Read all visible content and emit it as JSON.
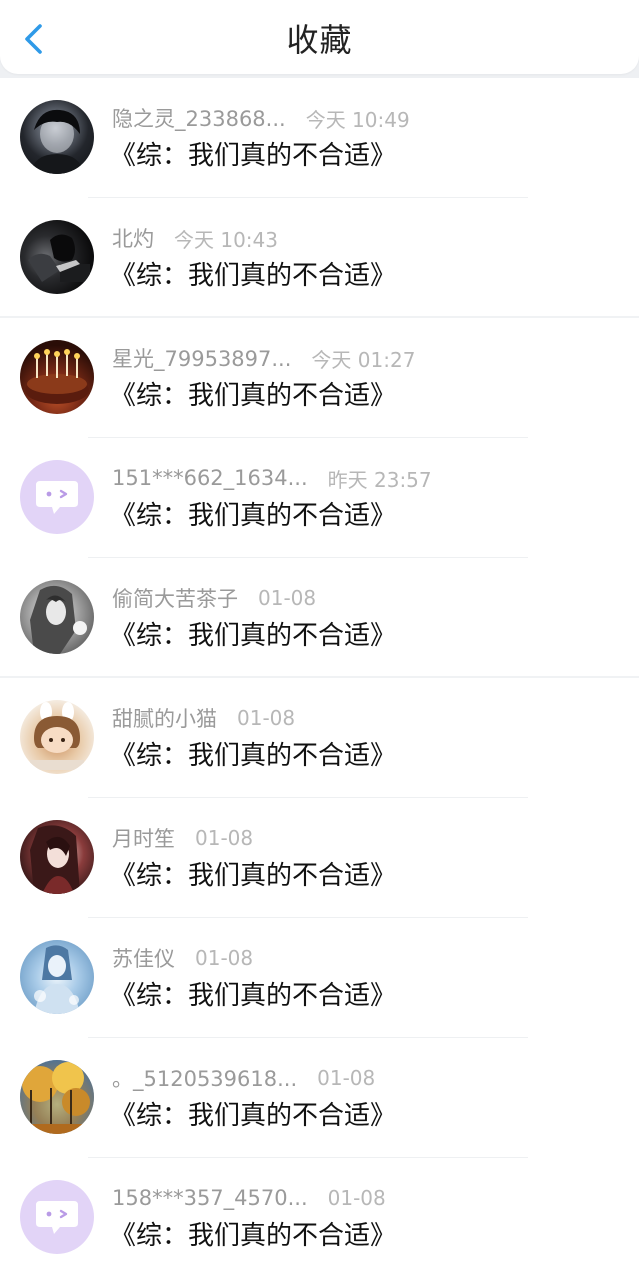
{
  "header": {
    "title": "收藏",
    "back_icon": "chevron-left-icon",
    "accent_color": "#2f9ae8"
  },
  "items": [
    {
      "username": "隐之灵_233868...",
      "time": "今天 10:49",
      "title": "《综：我们真的不合适》",
      "avatar": "dark-portrait-avatar"
    },
    {
      "username": "北灼",
      "time": "今天 10:43",
      "title": "《综：我们真的不合适》",
      "avatar": "dark-portrait-avatar"
    },
    {
      "username": "星光_79953897...",
      "time": "今天 01:27",
      "title": "《综：我们真的不合适》",
      "avatar": "birthday-cake-avatar"
    },
    {
      "username": "151***662_1634...",
      "time": "昨天 23:57",
      "title": "《综：我们真的不合适》",
      "avatar": "default-chat-bubble-avatar"
    },
    {
      "username": "偷简大苦茶子",
      "time": "01-08",
      "title": "《综：我们真的不合适》",
      "avatar": "anime-sketch-avatar"
    },
    {
      "username": "甜腻的小猫",
      "time": "01-08",
      "title": "《综：我们真的不合适》",
      "avatar": "cute-cartoon-avatar"
    },
    {
      "username": "月时笙",
      "time": "01-08",
      "title": "《综：我们真的不合适》",
      "avatar": "anime-girl-avatar"
    },
    {
      "username": "苏佳仪",
      "time": "01-08",
      "title": "《综：我们真的不合适》",
      "avatar": "blue-anime-avatar"
    },
    {
      "username": "。_5120539618...",
      "time": "01-08",
      "title": "《综：我们真的不合适》",
      "avatar": "autumn-tree-avatar"
    },
    {
      "username": "158***357_4570...",
      "time": "01-08",
      "title": "《综：我们真的不合适》",
      "avatar": "default-chat-bubble-avatar"
    }
  ]
}
